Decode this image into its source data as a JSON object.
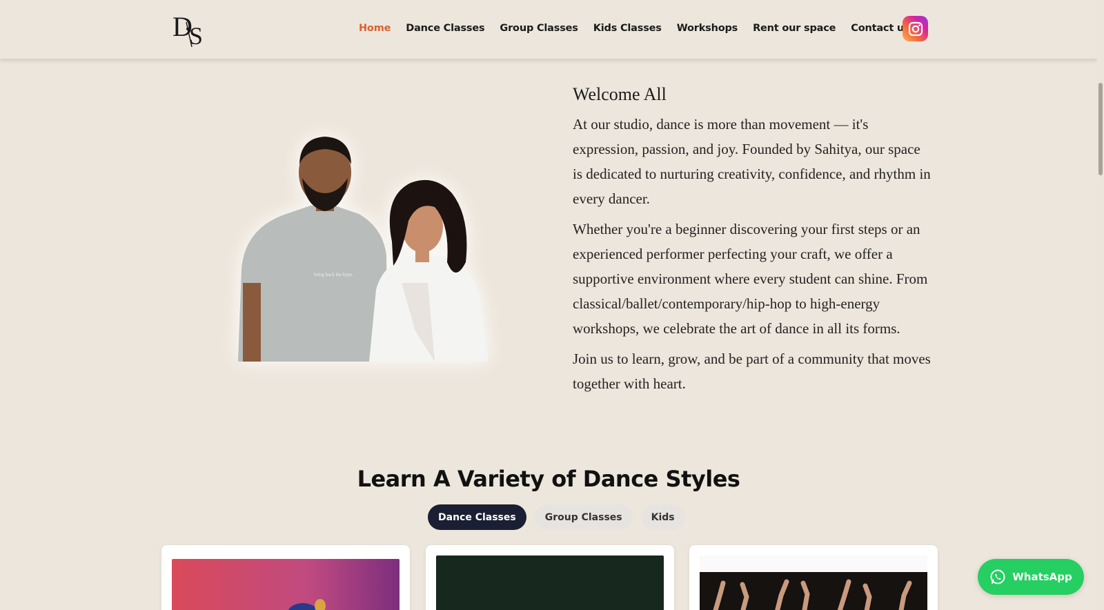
{
  "header": {
    "logo_text": "DS",
    "nav": [
      {
        "label": "Home",
        "active": true
      },
      {
        "label": "Dance Classes"
      },
      {
        "label": "Group Classes"
      },
      {
        "label": "Kids Classes"
      },
      {
        "label": "Workshops"
      },
      {
        "label": "Rent our space"
      },
      {
        "label": "Contact us"
      }
    ],
    "social_icon": "instagram-icon"
  },
  "welcome": {
    "title": "Welcome All",
    "paragraphs": [
      "At our studio, dance is more than movement — it's expression, passion, and joy. Founded by Sahitya, our space is dedicated to nurturing creativity, confidence, and rhythm in every dancer.",
      "Whether you're a beginner discovering your first steps or an experienced performer perfecting your craft, we offer a supportive environment where every student can shine. From classical/ballet/contemporary/hip-hop to high-energy workshops, we celebrate the art of dance in all its forms.",
      "Join us to learn, grow, and be part of a community that moves together with heart."
    ],
    "tshirt_text": "bring back the hype."
  },
  "styles_section": {
    "title": "Learn A Variety of Dance Styles",
    "tabs": [
      {
        "label": "Dance Classes",
        "active": true
      },
      {
        "label": "Group Classes"
      },
      {
        "label": "Kids"
      }
    ]
  },
  "whatsapp": {
    "label": "WhatsApp"
  },
  "colors": {
    "background": "#ede6dc",
    "nav_active": "#d9612f",
    "tab_active": "#1b1f33",
    "whatsapp": "#25cf61"
  }
}
